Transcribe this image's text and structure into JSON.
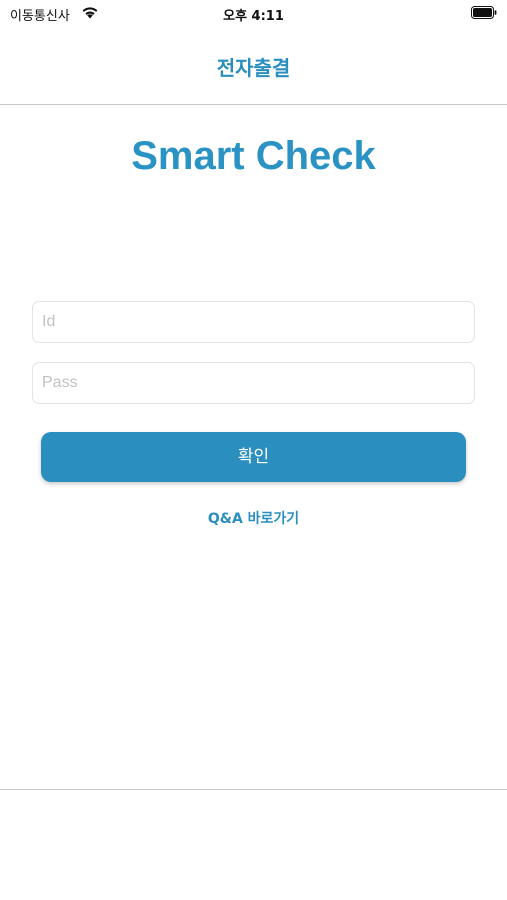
{
  "status_bar": {
    "carrier": "이동통신사",
    "time": "오후 4:11",
    "wifi_icon": "wifi-icon",
    "battery_icon": "battery-icon"
  },
  "nav": {
    "title": "전자출결"
  },
  "app_title": "Smart Check",
  "login": {
    "id_placeholder": "Id",
    "id_value": "",
    "pass_placeholder": "Pass",
    "pass_value": "",
    "confirm_label": "확인"
  },
  "qa_link": "Q&A 바로가기",
  "colors": {
    "accent": "#2a8fbf",
    "title": "#2a93c3",
    "divider": "#c8c8cc"
  }
}
